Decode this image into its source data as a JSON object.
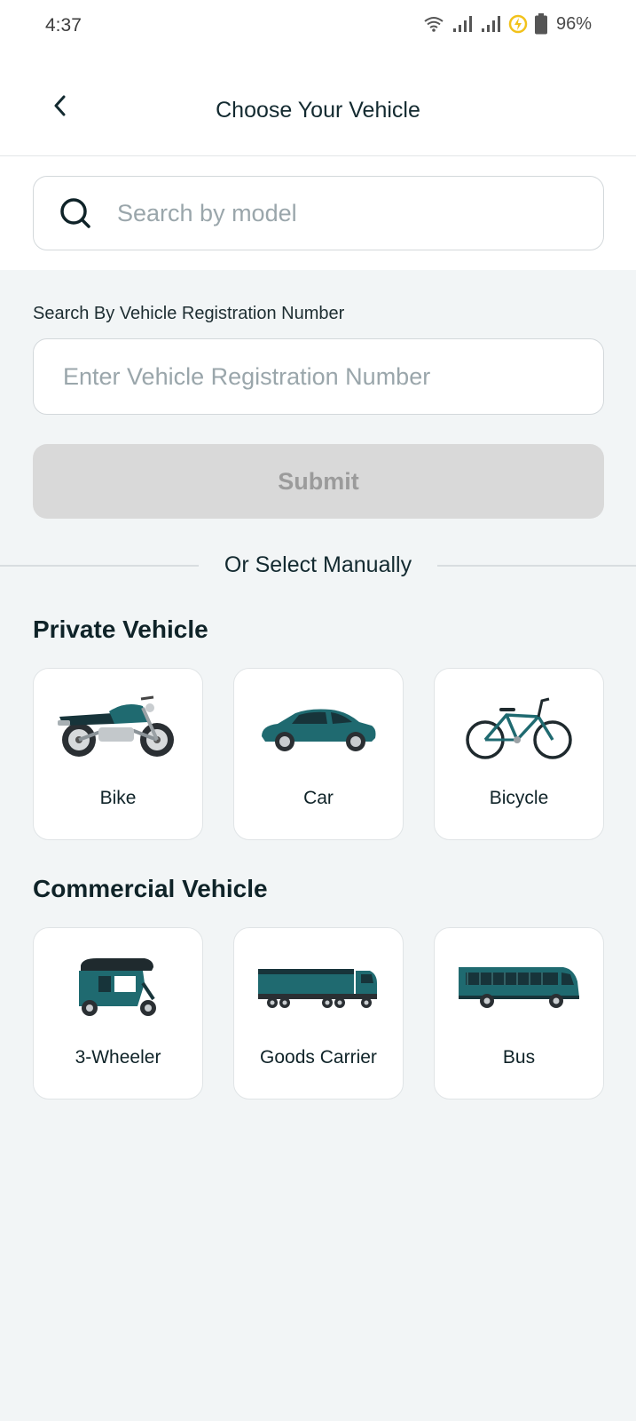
{
  "status_bar": {
    "time": "4:37",
    "battery": "96%"
  },
  "header": {
    "title": "Choose Your Vehicle"
  },
  "search": {
    "placeholder": "Search by model"
  },
  "registration": {
    "label": "Search By Vehicle Registration Number",
    "placeholder": "Enter Vehicle Registration Number",
    "submit_label": "Submit"
  },
  "divider_text": "Or Select Manually",
  "sections": [
    {
      "title": "Private Vehicle",
      "items": [
        {
          "label": "Bike",
          "icon": "motorcycle-icon"
        },
        {
          "label": "Car",
          "icon": "car-icon"
        },
        {
          "label": "Bicycle",
          "icon": "bicycle-icon"
        }
      ]
    },
    {
      "title": "Commercial Vehicle",
      "items": [
        {
          "label": "3-Wheeler",
          "icon": "auto-rickshaw-icon"
        },
        {
          "label": "Goods Carrier",
          "icon": "truck-icon"
        },
        {
          "label": "Bus",
          "icon": "bus-icon"
        }
      ]
    }
  ],
  "colors": {
    "accent": "#1f6a70",
    "dark": "#17343a",
    "submit_disabled": "#d9d9d9"
  }
}
